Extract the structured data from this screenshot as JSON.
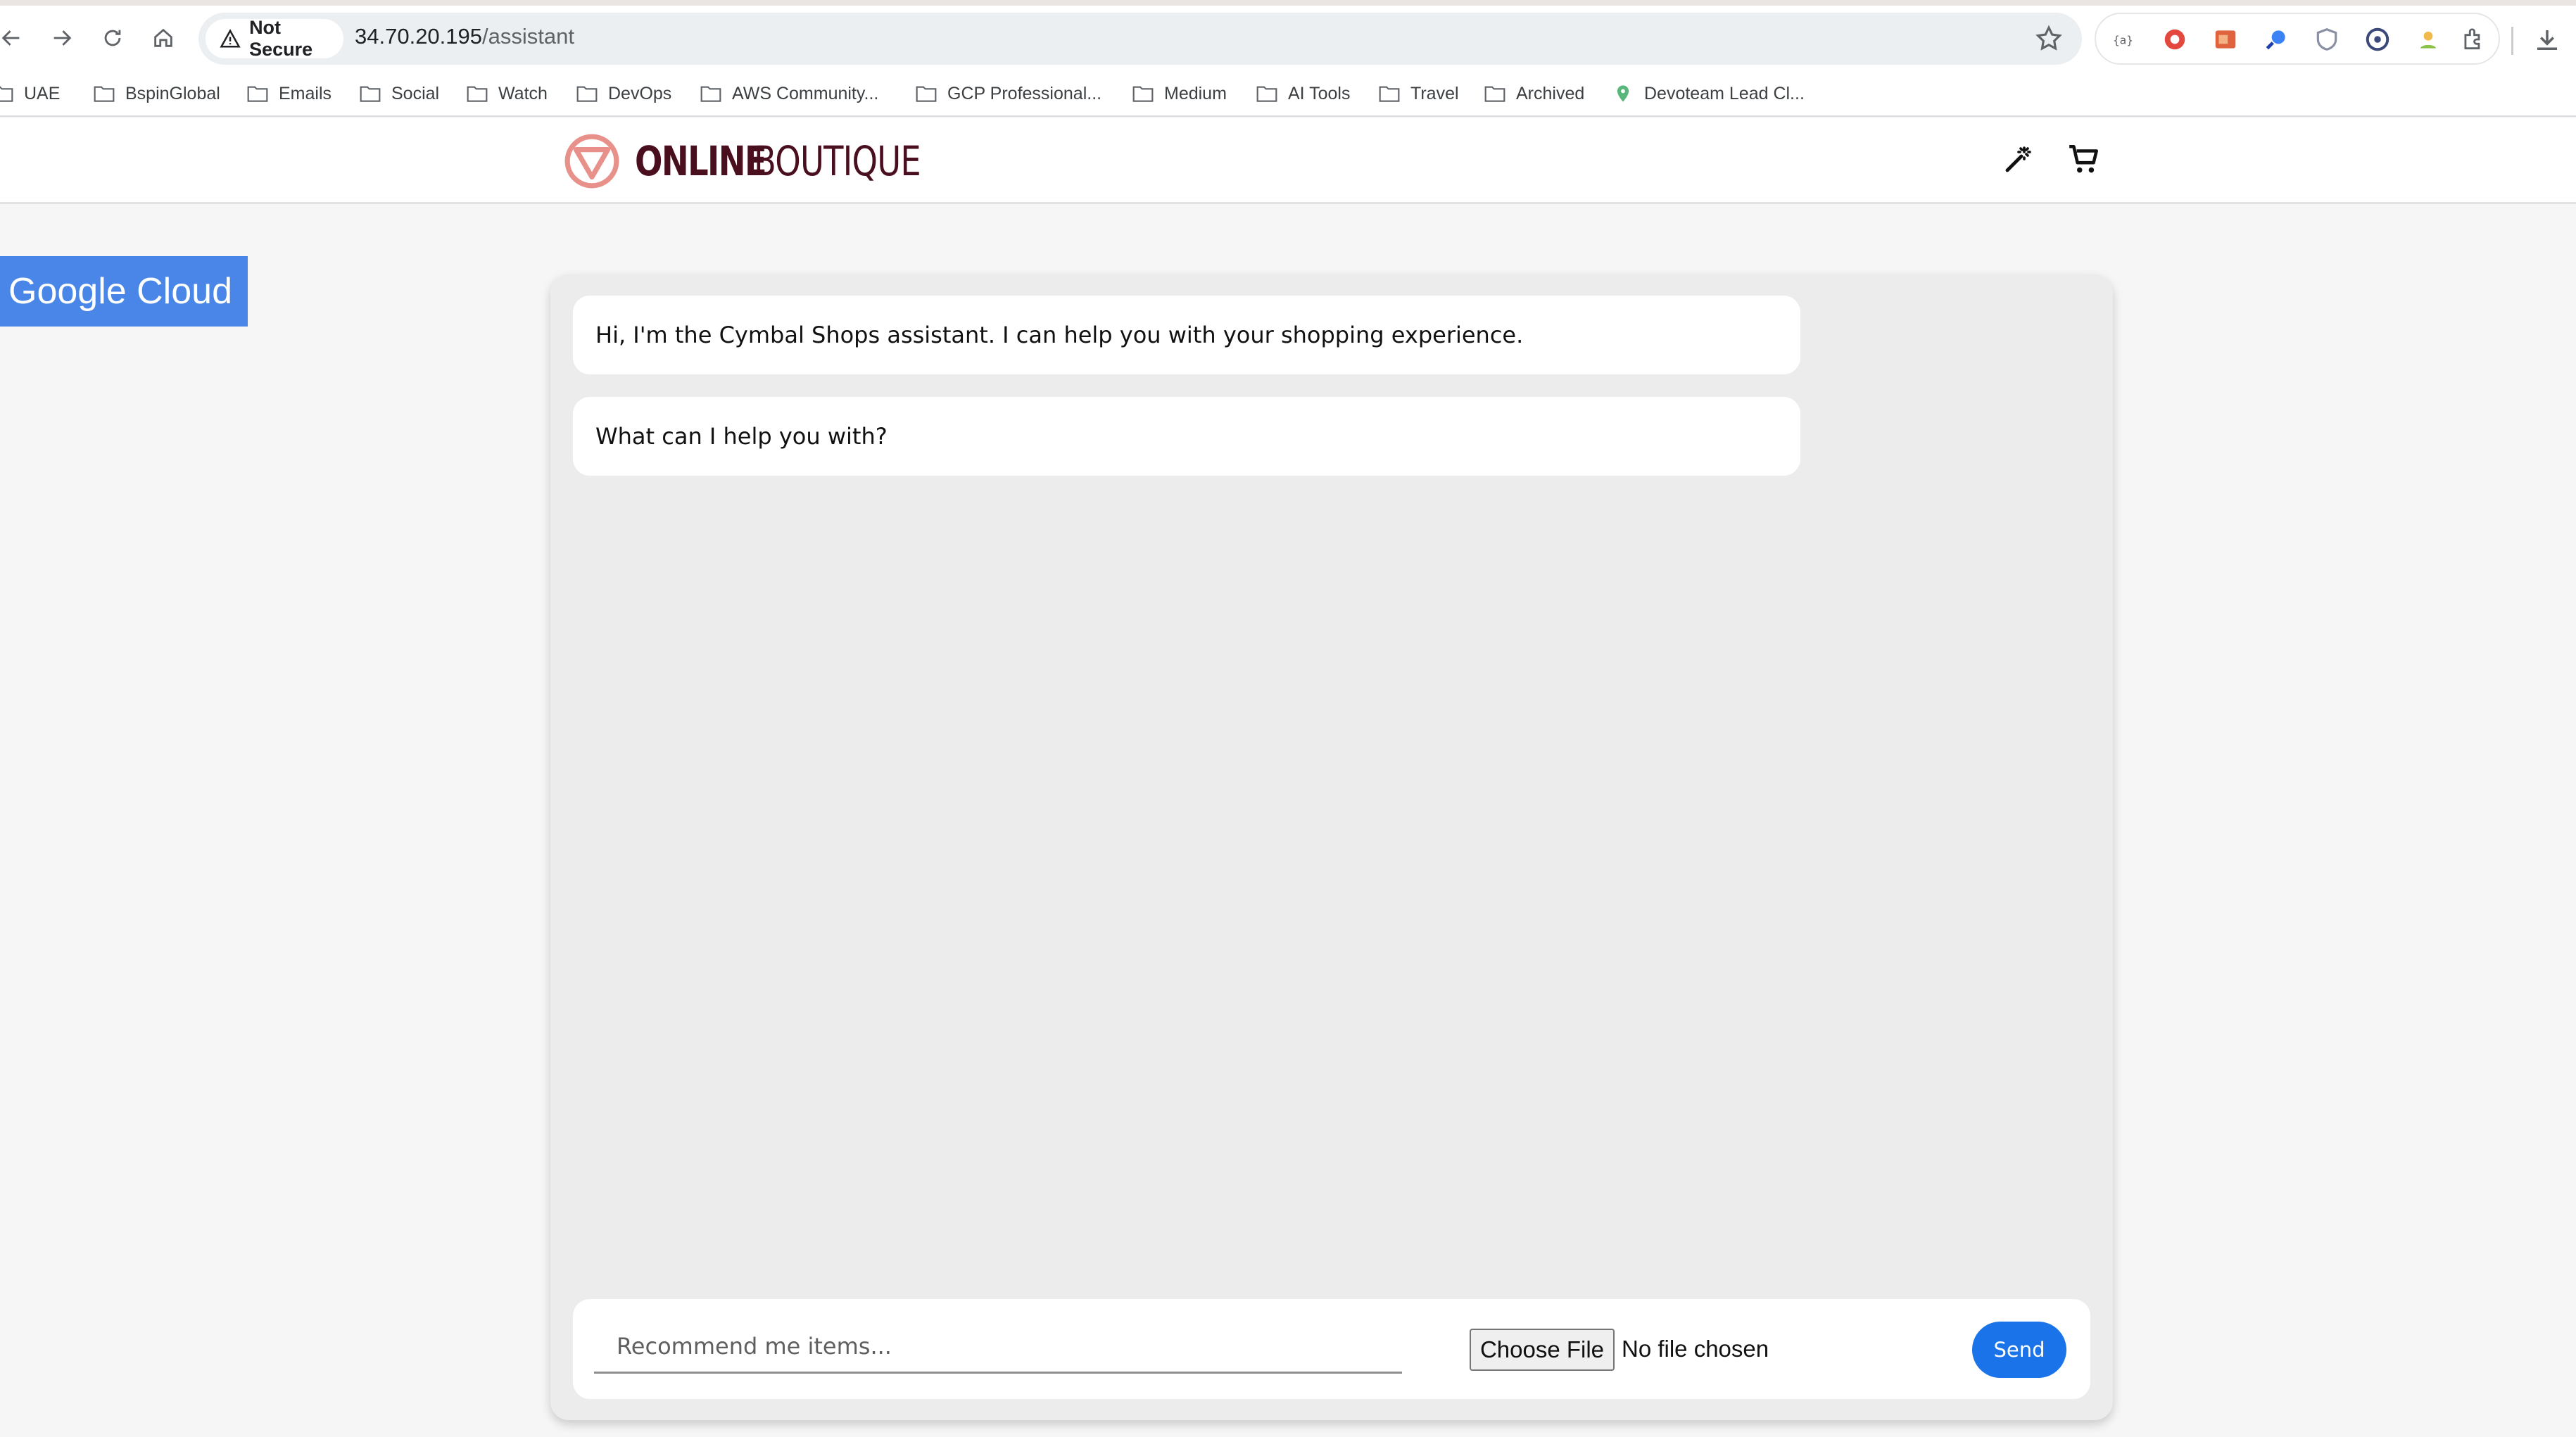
{
  "browser": {
    "security_label": "Not Secure",
    "url_host": "34.70.20.195",
    "url_path": "/assistant",
    "bookmarks": [
      {
        "label": "UAE",
        "icon": "folder-icon"
      },
      {
        "label": "BspinGlobal",
        "icon": "folder-icon"
      },
      {
        "label": "Emails",
        "icon": "folder-icon"
      },
      {
        "label": "Social",
        "icon": "folder-icon"
      },
      {
        "label": "Watch",
        "icon": "folder-icon"
      },
      {
        "label": "DevOps",
        "icon": "folder-icon"
      },
      {
        "label": "AWS Community...",
        "icon": "folder-icon"
      },
      {
        "label": "GCP Professional...",
        "icon": "folder-icon"
      },
      {
        "label": "Medium",
        "icon": "folder-icon"
      },
      {
        "label": "AI Tools",
        "icon": "folder-icon"
      },
      {
        "label": "Travel",
        "icon": "folder-icon"
      },
      {
        "label": "Archived",
        "icon": "folder-icon"
      },
      {
        "label": "Devoteam Lead Cl...",
        "icon": "location-pin-icon"
      }
    ],
    "accent_color": "#1a73e8"
  },
  "site": {
    "logo_part1": "ONLINE",
    "logo_part2": "BOUTIQUE",
    "logo_color": "#4a0f1f",
    "logo_mark_color": "#e8908a"
  },
  "badge": {
    "label": "Google Cloud",
    "color": "#4a86e8"
  },
  "chat": {
    "messages": [
      {
        "text": "Hi, I'm the Cymbal Shops assistant. I can help you with your shopping experience."
      },
      {
        "text": "What can I help you with?"
      }
    ],
    "input_placeholder": "Recommend me items...",
    "input_value": "",
    "choose_file_label": "Choose File",
    "file_status": "No file chosen",
    "send_label": "Send"
  }
}
